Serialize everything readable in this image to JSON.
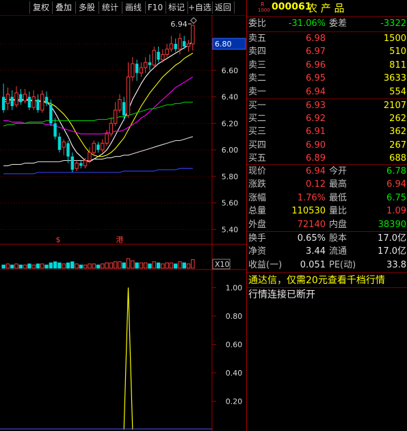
{
  "toolbar": {
    "items": [
      "复权",
      "叠加",
      "多股",
      "统计",
      "画线",
      "F10",
      "标记",
      "+自选",
      "返回"
    ]
  },
  "chart": {
    "price_axis": [
      "6.80",
      "6.60",
      "6.40",
      "6.20",
      "6.00",
      "5.80",
      "5.60",
      "5.40"
    ],
    "current_price_tag": "6.80",
    "high_label": "6.94",
    "event_marks": [
      "$",
      "港"
    ],
    "volume_unit_label": "X10",
    "indicator_axis": [
      "1.00",
      "0.80",
      "0.60",
      "0.40",
      "0.20"
    ]
  },
  "chart_data": {
    "type": "candlestick",
    "price_ylim": [
      5.35,
      6.95
    ],
    "candles": [
      [
        6.4,
        6.3,
        6.5,
        6.28
      ],
      [
        6.35,
        6.42,
        6.47,
        6.3
      ],
      [
        6.4,
        6.33,
        6.45,
        6.3
      ],
      [
        6.34,
        6.43,
        6.48,
        6.32
      ],
      [
        6.42,
        6.36,
        6.46,
        6.34
      ],
      [
        6.37,
        6.42,
        6.46,
        6.35
      ],
      [
        6.4,
        6.32,
        6.44,
        6.3
      ],
      [
        6.32,
        6.4,
        6.45,
        6.3
      ],
      [
        6.38,
        6.3,
        6.42,
        6.28
      ],
      [
        6.3,
        6.42,
        6.45,
        6.28
      ],
      [
        6.4,
        6.35,
        6.44,
        6.33
      ],
      [
        6.34,
        6.2,
        6.38,
        6.18
      ],
      [
        6.2,
        6.1,
        6.24,
        6.08
      ],
      [
        6.1,
        6.0,
        6.13,
        5.98
      ],
      [
        6.02,
        6.06,
        6.08,
        5.96
      ],
      [
        6.05,
        5.95,
        6.07,
        5.9
      ],
      [
        5.95,
        5.85,
        5.98,
        5.83
      ],
      [
        5.86,
        5.9,
        5.92,
        5.84
      ],
      [
        5.9,
        5.88,
        5.92,
        5.86
      ],
      [
        5.88,
        5.92,
        5.94,
        5.86
      ],
      [
        5.92,
        5.98,
        6.02,
        5.9
      ],
      [
        5.98,
        6.05,
        6.07,
        5.95
      ],
      [
        6.04,
        6.0,
        6.06,
        5.98
      ],
      [
        6.0,
        6.05,
        6.08,
        5.98
      ],
      [
        6.05,
        6.12,
        6.15,
        6.03
      ],
      [
        6.12,
        6.2,
        6.24,
        6.1
      ],
      [
        6.2,
        6.3,
        6.36,
        6.18
      ],
      [
        6.3,
        6.38,
        6.42,
        6.28
      ],
      [
        6.36,
        6.26,
        6.4,
        6.22
      ],
      [
        6.26,
        6.55,
        6.66,
        6.24
      ],
      [
        6.55,
        6.65,
        6.7,
        6.52
      ],
      [
        6.65,
        6.58,
        6.68,
        6.52
      ],
      [
        6.58,
        6.62,
        6.66,
        6.55
      ],
      [
        6.62,
        6.66,
        6.7,
        6.58
      ],
      [
        6.66,
        6.64,
        6.72,
        6.6
      ],
      [
        6.64,
        6.75,
        6.78,
        6.62
      ],
      [
        6.74,
        6.68,
        6.78,
        6.66
      ],
      [
        6.68,
        6.72,
        6.76,
        6.66
      ],
      [
        6.72,
        6.76,
        6.8,
        6.7
      ],
      [
        6.76,
        6.8,
        6.86,
        6.74
      ],
      [
        6.8,
        6.76,
        6.84,
        6.74
      ],
      [
        6.76,
        6.84,
        6.88,
        6.72
      ],
      [
        6.82,
        6.78,
        6.86,
        6.76
      ],
      [
        6.78,
        6.8,
        6.83,
        6.74
      ],
      [
        6.8,
        6.94,
        6.94,
        6.75
      ]
    ],
    "ma_series": [
      {
        "color": "#ffffff",
        "values": [
          6.38,
          6.38,
          6.38,
          6.37,
          6.37,
          6.38,
          6.37,
          6.37,
          6.37,
          6.37,
          6.36,
          6.33,
          6.28,
          6.22,
          6.16,
          6.1,
          6.03,
          5.98,
          5.95,
          5.92,
          5.91,
          5.93,
          5.95,
          5.97,
          6.0,
          6.05,
          6.11,
          6.17,
          6.23,
          6.3,
          6.38,
          6.44,
          6.5,
          6.55,
          6.59,
          6.62,
          6.65,
          6.67,
          6.69,
          6.71,
          6.73,
          6.75,
          6.77,
          6.79,
          6.82
        ]
      },
      {
        "color": "#ffff00",
        "values": [
          6.36,
          6.37,
          6.38,
          6.38,
          6.38,
          6.38,
          6.38,
          6.37,
          6.37,
          6.36,
          6.36,
          6.35,
          6.33,
          6.3,
          6.27,
          6.23,
          6.18,
          6.12,
          6.07,
          6.02,
          5.98,
          5.96,
          5.95,
          5.95,
          5.96,
          5.98,
          6.01,
          6.05,
          6.09,
          6.15,
          6.21,
          6.27,
          6.33,
          6.38,
          6.43,
          6.47,
          6.51,
          6.55,
          6.58,
          6.61,
          6.64,
          6.66,
          6.69,
          6.71,
          6.73
        ]
      },
      {
        "color": "#ff00ff",
        "values": [
          6.22,
          6.22,
          6.21,
          6.21,
          6.21,
          6.2,
          6.2,
          6.2,
          6.2,
          6.2,
          6.19,
          6.19,
          6.18,
          6.17,
          6.16,
          6.15,
          6.14,
          6.13,
          6.12,
          6.12,
          6.12,
          6.12,
          6.12,
          6.12,
          6.13,
          6.13,
          6.14,
          6.14,
          6.15,
          6.17,
          6.19,
          6.21,
          6.24,
          6.26,
          6.29,
          6.32,
          6.35,
          6.38,
          6.41,
          6.44,
          6.47,
          6.49,
          6.51,
          6.53,
          6.55
        ]
      },
      {
        "color": "#00cc00",
        "values": [
          6.18,
          6.19,
          6.19,
          6.2,
          6.2,
          6.2,
          6.21,
          6.21,
          6.21,
          6.21,
          6.22,
          6.22,
          6.22,
          6.22,
          6.22,
          6.22,
          6.22,
          6.22,
          6.22,
          6.22,
          6.22,
          6.22,
          6.23,
          6.23,
          6.23,
          6.24,
          6.24,
          6.25,
          6.25,
          6.26,
          6.27,
          6.28,
          6.29,
          6.3,
          6.31,
          6.31,
          6.32,
          6.33,
          6.34,
          6.34,
          6.35,
          6.35,
          6.36,
          6.36,
          6.36
        ]
      },
      {
        "color": "#dddddd",
        "values": [
          5.88,
          5.88,
          5.89,
          5.89,
          5.89,
          5.9,
          5.9,
          5.9,
          5.91,
          5.91,
          5.91,
          5.91,
          5.91,
          5.91,
          5.92,
          5.92,
          5.92,
          5.92,
          5.92,
          5.92,
          5.92,
          5.93,
          5.93,
          5.93,
          5.94,
          5.94,
          5.95,
          5.95,
          5.96,
          5.96,
          5.97,
          5.98,
          5.99,
          6.0,
          6.01,
          6.02,
          6.03,
          6.04,
          6.05,
          6.06,
          6.07,
          6.07,
          6.08,
          6.09,
          6.1
        ]
      },
      {
        "color": "#3344ff",
        "values": [
          5.82,
          5.82,
          5.82,
          5.82,
          5.82,
          5.82,
          5.82,
          5.82,
          5.83,
          5.83,
          5.83,
          5.83,
          5.83,
          5.83,
          5.83,
          5.83,
          5.83,
          5.83,
          5.83,
          5.83,
          5.83,
          5.83,
          5.83,
          5.83,
          5.83,
          5.83,
          5.83,
          5.83,
          5.84,
          5.84,
          5.84,
          5.84,
          5.84,
          5.84,
          5.84,
          5.84,
          5.85,
          5.85,
          5.85,
          5.85,
          5.85,
          5.86,
          5.86,
          5.86,
          5.86
        ]
      }
    ],
    "volume": [
      3,
      4,
      3,
      4,
      3,
      3,
      4,
      3,
      4,
      4,
      3,
      5,
      6,
      5,
      4,
      5,
      6,
      4,
      3,
      3,
      4,
      4,
      3,
      4,
      5,
      5,
      6,
      6,
      5,
      9,
      7,
      5,
      5,
      5,
      4,
      6,
      5,
      4,
      5,
      5,
      4,
      6,
      5,
      4,
      8
    ],
    "indicator_ylim": [
      0,
      1.05
    ],
    "indicator_values": [
      0,
      0,
      0,
      0,
      0,
      0,
      0,
      0,
      0,
      0,
      0,
      0,
      0,
      0,
      0,
      0,
      0,
      0,
      0,
      0,
      0,
      0,
      0,
      0,
      0,
      0,
      0,
      0,
      0,
      1.0,
      0,
      0,
      0,
      0,
      0,
      0,
      0,
      0,
      0,
      0,
      0,
      0,
      0,
      0,
      0
    ]
  },
  "panel": {
    "badge_top": "R",
    "badge_bottom": "1000",
    "code": "000061",
    "name": "农 产 品",
    "weibi_label": "委比",
    "weibi_value": "-31.06%",
    "weicha_label": "委差",
    "weicha_value": "-3322",
    "asks": [
      {
        "label": "卖五",
        "price": "6.98",
        "vol": "1500"
      },
      {
        "label": "卖四",
        "price": "6.97",
        "vol": "510"
      },
      {
        "label": "卖三",
        "price": "6.96",
        "vol": "811"
      },
      {
        "label": "卖二",
        "price": "6.95",
        "vol": "3633"
      },
      {
        "label": "卖一",
        "price": "6.94",
        "vol": "554"
      }
    ],
    "bids": [
      {
        "label": "买一",
        "price": "6.93",
        "vol": "2107"
      },
      {
        "label": "买二",
        "price": "6.92",
        "vol": "262"
      },
      {
        "label": "买三",
        "price": "6.91",
        "vol": "362"
      },
      {
        "label": "买四",
        "price": "6.90",
        "vol": "267"
      },
      {
        "label": "买五",
        "price": "6.89",
        "vol": "688"
      }
    ],
    "stats": [
      {
        "l1": "现价",
        "v1": "6.94",
        "c1": "red",
        "l2": "今开",
        "v2": "6.78",
        "c2": "green"
      },
      {
        "l1": "涨跌",
        "v1": "0.12",
        "c1": "red",
        "l2": "最高",
        "v2": "6.94",
        "c2": "red"
      },
      {
        "l1": "涨幅",
        "v1": "1.76%",
        "c1": "red",
        "l2": "最低",
        "v2": "6.75",
        "c2": "green"
      },
      {
        "l1": "总量",
        "v1": "110530",
        "c1": "yellow",
        "l2": "量比",
        "v2": "1.09",
        "c2": "red"
      },
      {
        "l1": "外盘",
        "v1": "72140",
        "c1": "red",
        "l2": "内盘",
        "v2": "38390",
        "c2": "green"
      }
    ],
    "fund": [
      {
        "l1": "换手",
        "v1": "0.65%",
        "l2": "股本",
        "v2": "17.0亿"
      },
      {
        "l1": "净资",
        "v1": "3.44",
        "l2": "流通",
        "v2": "17.0亿"
      },
      {
        "l1": "收益(一)",
        "v1": "0.051",
        "l2": "PE(动)",
        "v2": "33.8"
      }
    ],
    "promo": "通达信，仅需20元查看千档行情",
    "status": "行情连接已断开"
  }
}
